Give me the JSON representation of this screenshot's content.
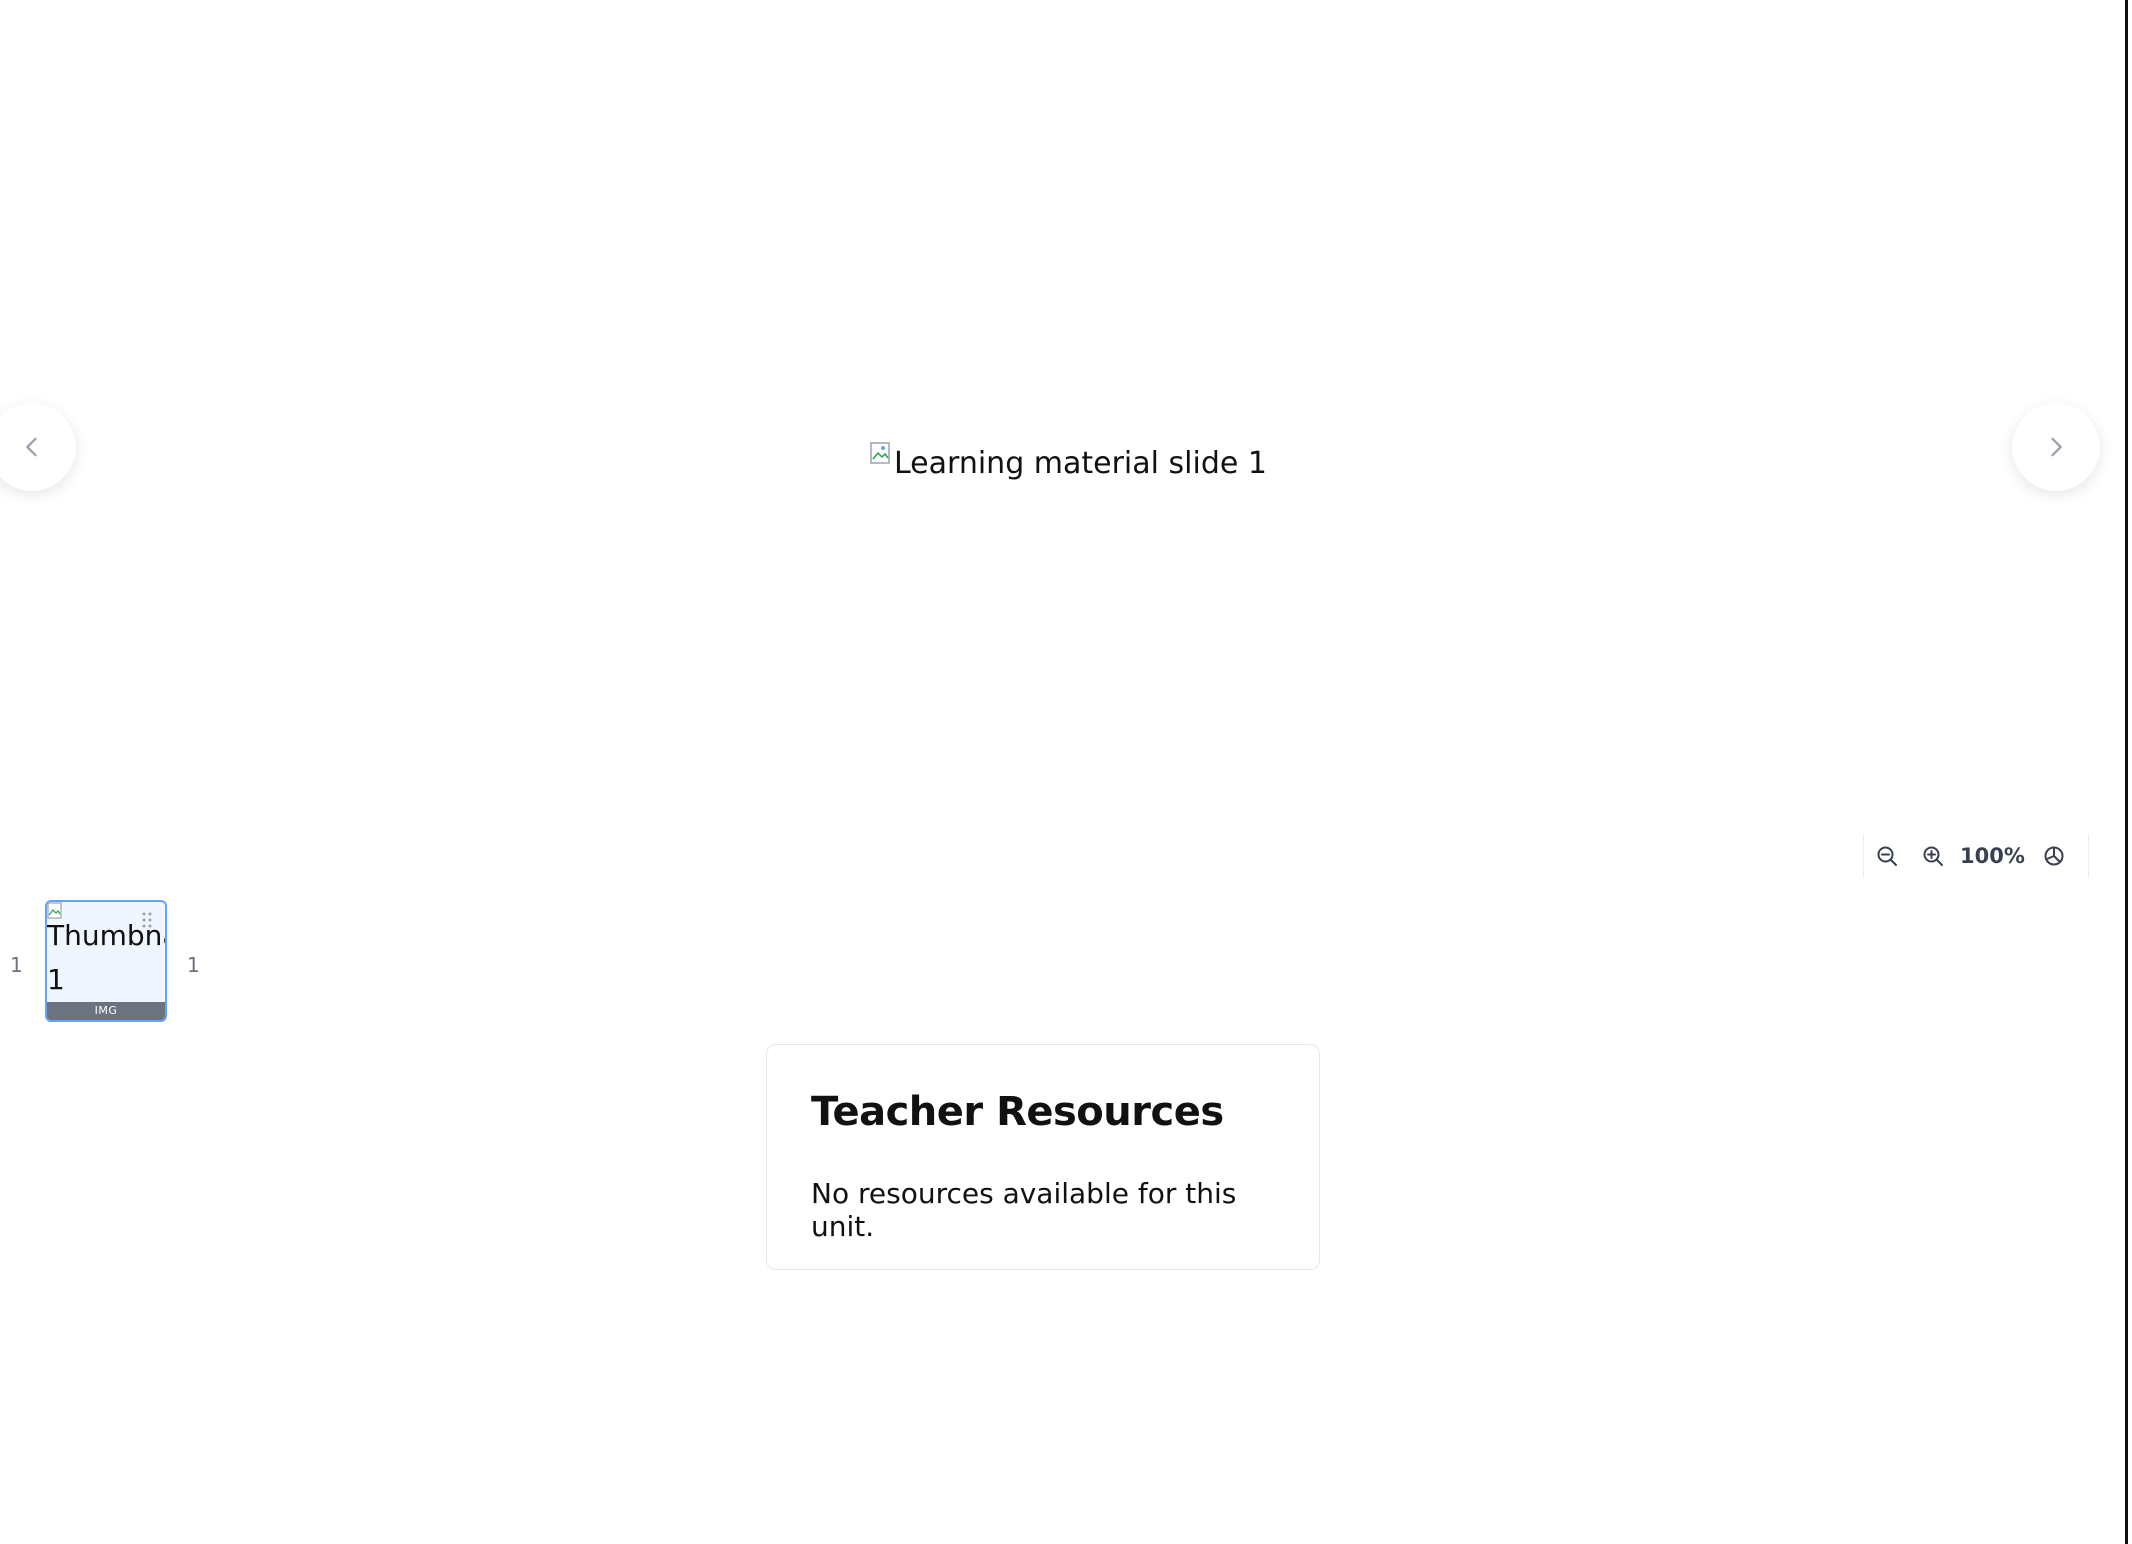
{
  "viewer": {
    "slide_alt": "Learning material slide 1",
    "prev_icon": "chevron-left-icon",
    "next_icon": "chevron-right-icon"
  },
  "zoom": {
    "level": "100%",
    "zoom_out_icon": "zoom-out-icon",
    "zoom_in_icon": "zoom-in-icon",
    "reset_icon": "reset-zoom-icon"
  },
  "thumbnails": {
    "index_left": "1",
    "index_right": "1",
    "items": [
      {
        "alt_text": "Thumbna",
        "alt_number": "1",
        "type_badge": "IMG",
        "selected": true
      }
    ]
  },
  "resources": {
    "title": "Teacher Resources",
    "empty_message": "No resources available for this unit."
  },
  "colors": {
    "selected_border": "#60a5fa",
    "selected_bg": "#eff6ff",
    "badge_bg": "#6b7280"
  }
}
